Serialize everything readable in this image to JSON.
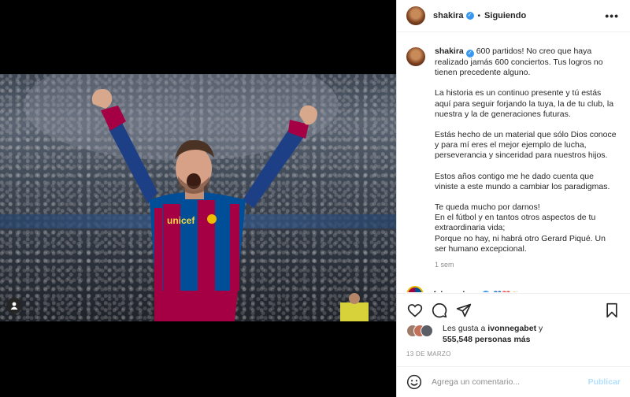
{
  "post": {
    "username": "shakira",
    "verified_mark": "✓",
    "separator": "•",
    "follow_status": "Siguiendo",
    "more_label": "•••"
  },
  "caption": {
    "username": "shakira",
    "paragraphs": [
      "600 partidos! No creo que haya realizado jamás 600 conciertos. Tus logros no tienen precedente alguno.",
      "La historia es un continuo presente y tú estás aquí para seguir forjando la tuya, la de tu club, la nuestra y la de generaciones futuras.",
      "Estás hecho de un material que sólo Dios conoce y para mí eres el mejor ejemplo de lucha, perseverancia y sinceridad para nuestros hijos.",
      "Estos años contigo me he dado cuenta que viniste a este mundo a cambiar los paradigmas.",
      "Te queda mucho por darnos!\nEn el fútbol y en tantos otros aspectos de tu extraordinaria vida;\nPorque no hay, ni habrá otro Gerard Piqué. Un ser humano excepcional."
    ],
    "time_ago": "1 sem"
  },
  "comment": {
    "username": "fcbarcelona",
    "emojis": "💙❤️👏"
  },
  "photo": {
    "jersey_sponsor": "unicef"
  },
  "icons": {
    "like": "heart-icon",
    "comment": "comment-icon",
    "share": "share-icon",
    "save": "bookmark-icon",
    "tag": "user-tag-icon",
    "emoji": "emoji-icon"
  },
  "likes": {
    "prefix": "Les gusta a",
    "liker": "ivonnegabet",
    "connector": "y",
    "count_text": "555,548 personas más"
  },
  "date": "13 DE MARZO",
  "composer": {
    "placeholder": "Agrega un comentario...",
    "publish_label": "Publicar"
  },
  "colors": {
    "verified": "#3897f0",
    "publish_disabled": "#b2dffc",
    "barca_blue": "#004d98",
    "barca_red": "#a50044"
  }
}
